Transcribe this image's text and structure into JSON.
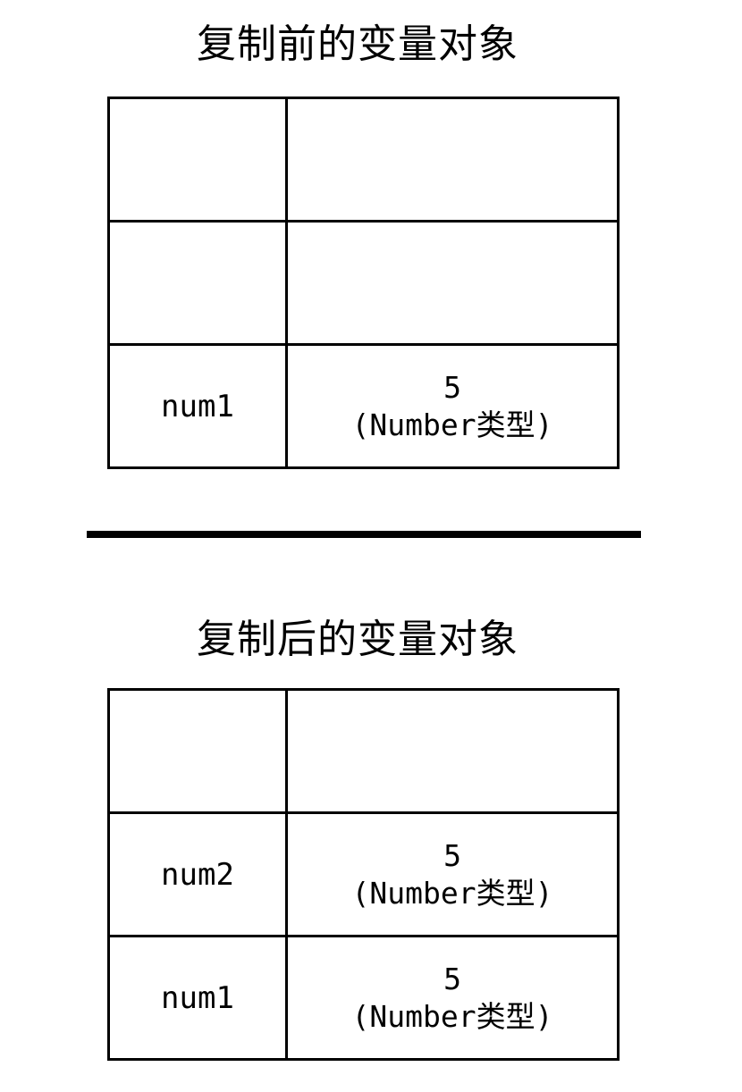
{
  "before": {
    "title": "复制前的变量对象",
    "rows": [
      {
        "name": "",
        "value": "",
        "type": ""
      },
      {
        "name": "",
        "value": "",
        "type": ""
      },
      {
        "name": "num1",
        "value": "5",
        "type": "(Number类型)"
      }
    ]
  },
  "after": {
    "title": "复制后的变量对象",
    "rows": [
      {
        "name": "",
        "value": "",
        "type": ""
      },
      {
        "name": "num2",
        "value": "5",
        "type": "(Number类型)"
      },
      {
        "name": "num1",
        "value": "5",
        "type": "(Number类型)"
      }
    ]
  }
}
